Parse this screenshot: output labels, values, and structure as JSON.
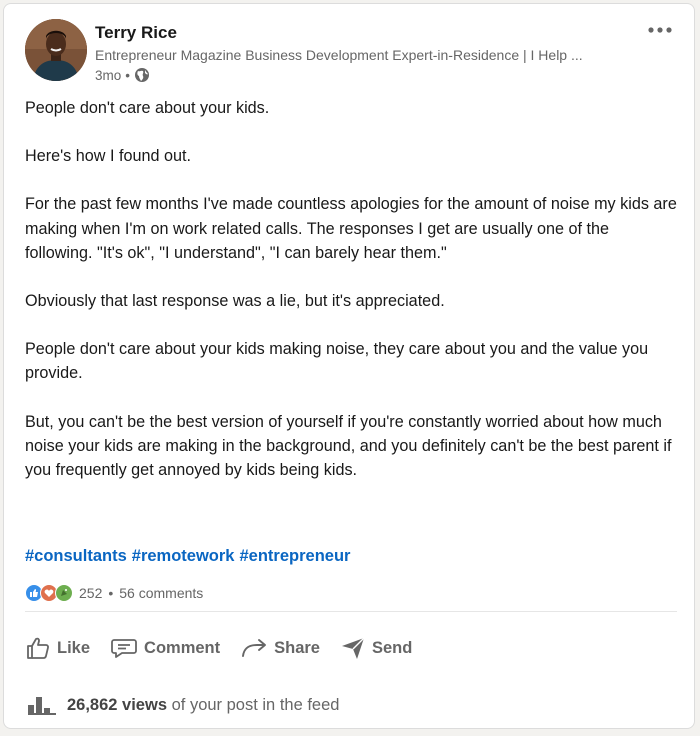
{
  "post": {
    "author": {
      "name": "Terry Rice",
      "headline": "Entrepreneur Magazine Business Development Expert-in-Residence | I Help ...",
      "time": "3mo",
      "separator": "•",
      "visibility_icon": "globe-icon",
      "avatar_icon": "avatar-photo"
    },
    "more_icon": "ellipsis-icon",
    "paragraphs": [
      "People don't care about your kids.",
      "Here's how I found out.",
      "For the past few months I've made countless apologies for the amount of noise my kids are making when I'm on work related calls. The responses I get are usually one of the following. \"It's ok\", \"I understand\", \"I can barely hear them.\"",
      "Obviously that last response was a lie, but it's appreciated.",
      "People don't care about your kids making noise, they care about you and the value you provide.",
      "But, you can't be the best version of yourself if you're constantly worried about how much noise your kids are making in the background, and you definitely can't be the best parent if you frequently get annoyed by kids being kids."
    ],
    "hashtags": [
      "#consultants",
      "#remotework",
      "#entrepreneur"
    ],
    "social": {
      "reactions": [
        {
          "icon": "like-reaction-icon",
          "color": "#378fe9"
        },
        {
          "icon": "love-reaction-icon",
          "color": "#df704d"
        },
        {
          "icon": "celebrate-reaction-icon",
          "color": "#44712e"
        }
      ],
      "reaction_count": "252",
      "separator": "•",
      "comments": "56 comments"
    },
    "actions": [
      {
        "label": "Like",
        "icon": "thumbs-up-icon"
      },
      {
        "label": "Comment",
        "icon": "comment-icon"
      },
      {
        "label": "Share",
        "icon": "share-arrow-icon"
      },
      {
        "label": "Send",
        "icon": "send-icon"
      }
    ],
    "views": {
      "count": "26,862 views",
      "suffix": "of your post in the feed",
      "icon": "bar-chart-icon"
    }
  },
  "colors": {
    "link": "#0a66c2",
    "muted": "#666666",
    "text": "#191919"
  }
}
